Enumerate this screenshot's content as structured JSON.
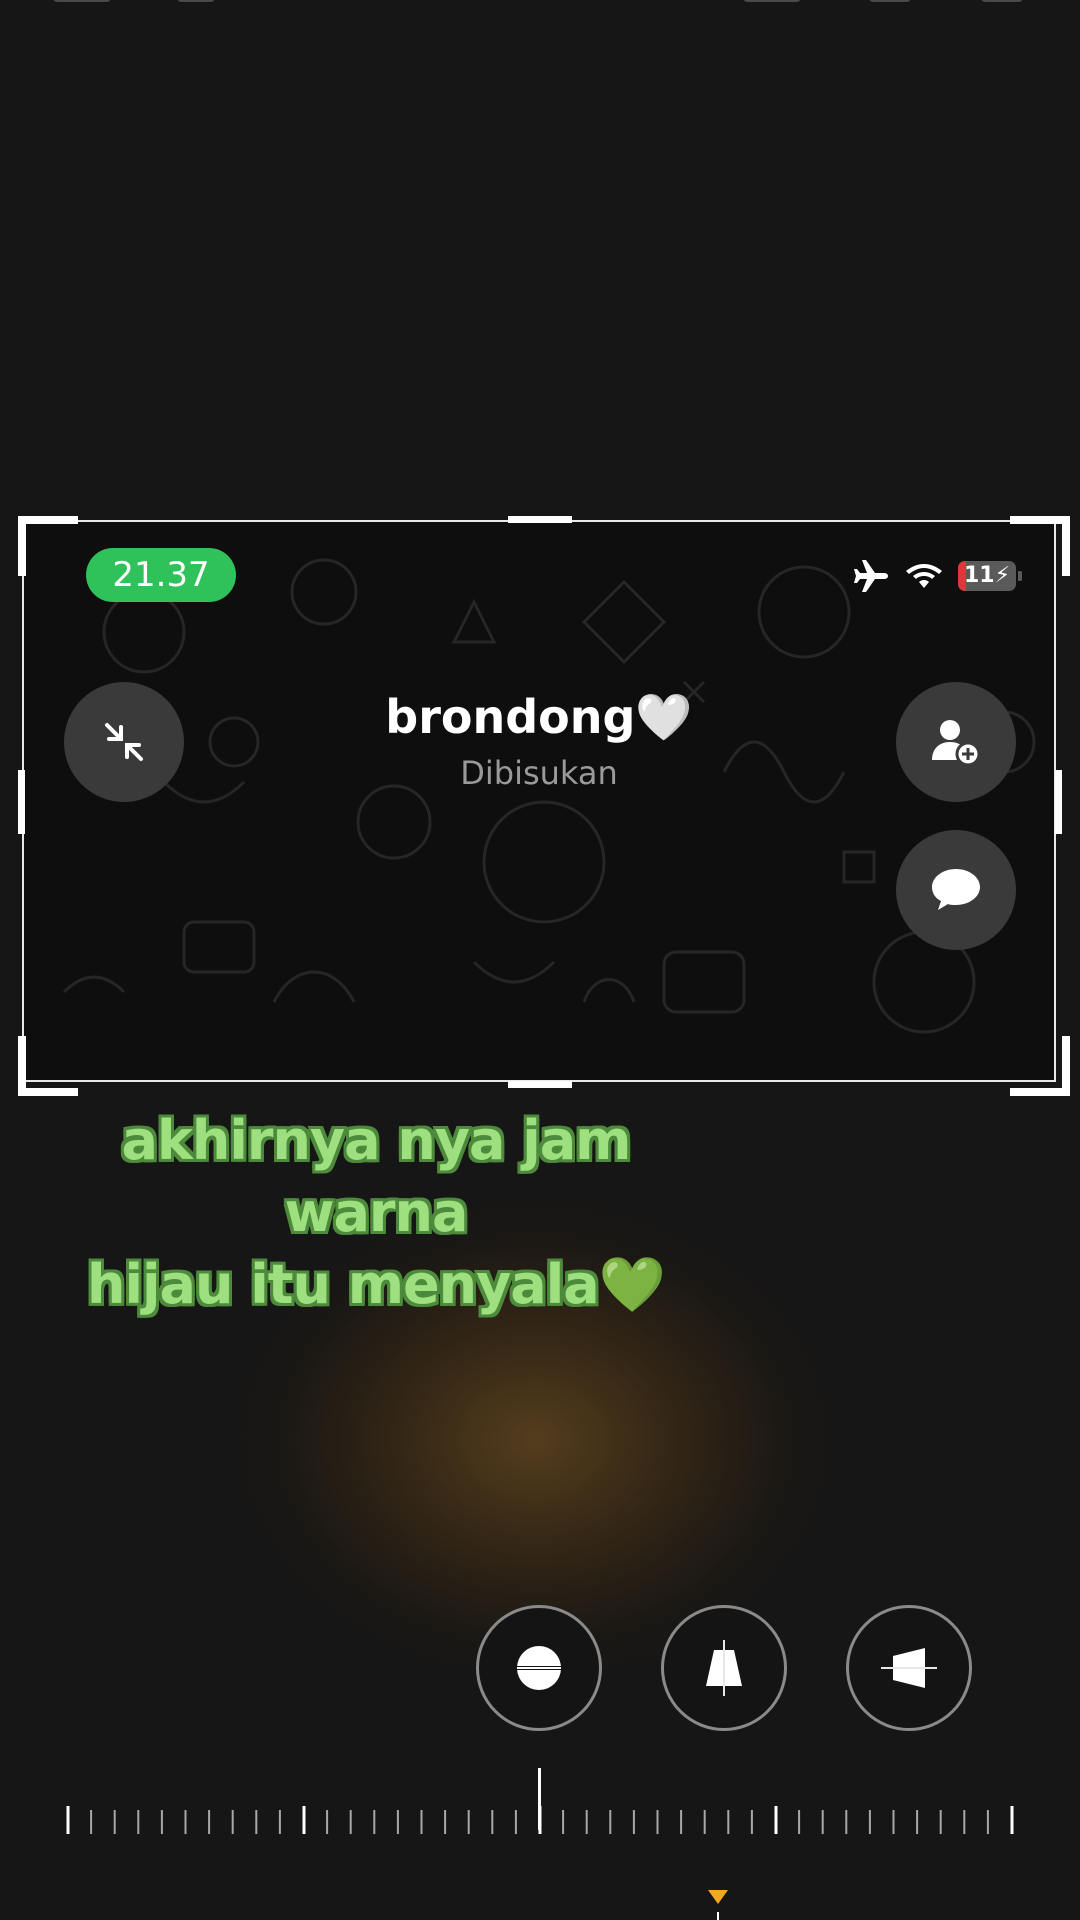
{
  "overlay": {
    "clock": "21.37",
    "battery_level": "11",
    "chat_title": "brondong🤍",
    "chat_status": "Dibisukan"
  },
  "caption": {
    "line1": "akhirnya nya jam warna",
    "line2": "hijau itu menyala",
    "emoji": "💚"
  },
  "colors": {
    "background": "#161616",
    "clock_pill": "#2fc25b",
    "caption_text": "#9ee07f",
    "caption_outline": "#4d8a3b",
    "battery_low": "#e0353a",
    "marker": "#f5a623"
  },
  "icons": {
    "minimize": "minimize-arrows-icon",
    "add_participant": "person-add-icon",
    "message": "chat-bubble-icon",
    "airplane": "airplane-mode-icon",
    "wifi": "wifi-icon",
    "battery": "battery-icon",
    "straighten": "straighten-icon",
    "vertical_perspective": "vertical-perspective-icon",
    "horizontal_perspective": "horizontal-perspective-icon"
  },
  "straighten_dial": {
    "value": 0
  }
}
